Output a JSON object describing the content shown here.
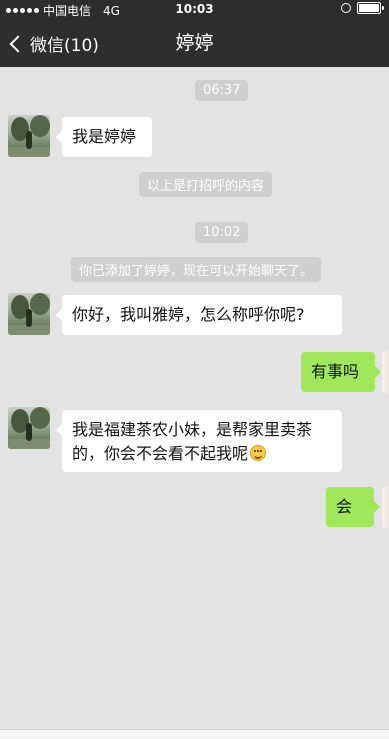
{
  "status_bar": {
    "carrier": "中国电信",
    "network": "4G",
    "time": "10:03"
  },
  "nav": {
    "back_label": "微信(10)",
    "title": "婷婷"
  },
  "chat": {
    "timestamp_1": "06:37",
    "msg_1": "我是婷婷",
    "sys_greeting": "以上是打招呼的内容",
    "timestamp_2": "10:02",
    "sys_added": "你已添加了婷婷，现在可以开始聊天了。",
    "msg_2": "你好，我叫雅婷，怎么称呼你呢?",
    "reply_1": "有事吗",
    "msg_3_line1": "我是福建茶农小妹，是帮家里卖茶",
    "msg_3_line2": "的，你会不会看不起我呢",
    "reply_2": "会"
  }
}
